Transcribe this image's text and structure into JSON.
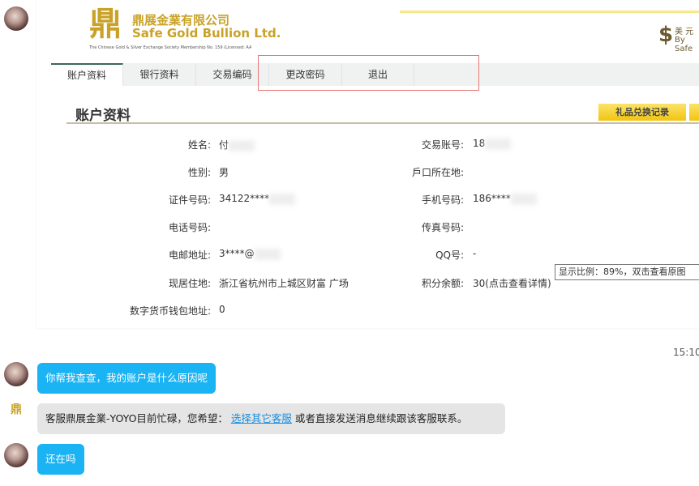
{
  "screenshot": {
    "logo": {
      "mark": "鼎",
      "name_cn": "鼎展金業有限公司",
      "name_en": "Safe Gold Bullion Ltd.",
      "membership": "The Chinese Gold & Silver Exchange Society Membership No. 159 (Licensed: AA)"
    },
    "usd_badge": {
      "line1": "美 元",
      "line2": "By Safe"
    },
    "tabs": [
      "账户资料",
      "银行资料",
      "交易编码",
      "更改密码",
      "退出"
    ],
    "page_title": "账户资料",
    "gift_button": "礼品兑换记录",
    "fields_left": [
      {
        "label": "姓名:",
        "value": "付"
      },
      {
        "label": "性别:",
        "value": "男"
      },
      {
        "label": "证件号码:",
        "value": "34122****"
      },
      {
        "label": "电话号码:",
        "value": ""
      },
      {
        "label": "电邮地址:",
        "value": "3****@"
      },
      {
        "label": "现居住地:",
        "value": "浙江省杭州市上城区财富 广场"
      },
      {
        "label": "数字货币钱包地址:",
        "value": "0"
      }
    ],
    "fields_right": [
      {
        "label": "交易账号:",
        "value": "18"
      },
      {
        "label": "戶口所在地:",
        "value": ""
      },
      {
        "label": "手机号码:",
        "value": "186****"
      },
      {
        "label": "传真号码:",
        "value": ""
      },
      {
        "label": "QQ号:",
        "value": "-"
      },
      {
        "label": "积分余额:",
        "value": "30(点击查看详情)"
      }
    ],
    "tooltip": "显示比例：89%，双击查看原图"
  },
  "chat": {
    "time": "15:10",
    "msg1": "你帮我查查，我的账户是什么原因呢",
    "msg2_pre": "客服鼎展金業-YOYO目前忙碌，您希望：",
    "msg2_link": "选择其它客服",
    "msg2_post": "或者直接发送消息继续跟该客服联系。",
    "msg3": "还在吗",
    "cs_logo": "鼎"
  },
  "colors": {
    "user_bubble": "#1ab3f3",
    "cs_bubble": "#e5e5e5",
    "gold": "#c9a227"
  }
}
